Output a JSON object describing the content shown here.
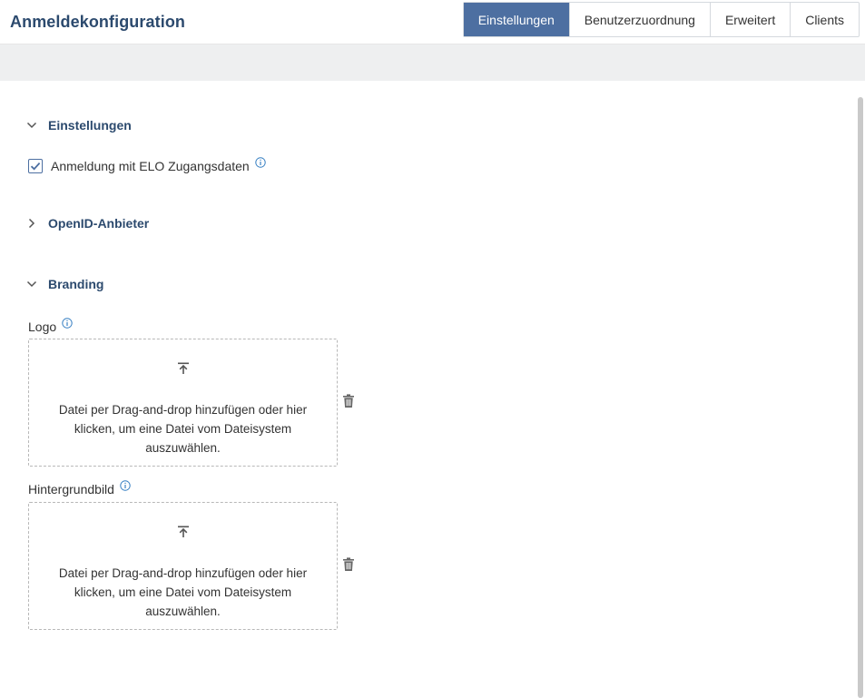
{
  "header": {
    "title": "Anmeldekonfiguration",
    "tabs": [
      {
        "label": "Einstellungen",
        "active": true
      },
      {
        "label": "Benutzerzuordnung",
        "active": false
      },
      {
        "label": "Erweitert",
        "active": false
      },
      {
        "label": "Clients",
        "active": false
      }
    ]
  },
  "sections": {
    "einstellungen": {
      "title": "Einstellungen",
      "expanded": true,
      "checkbox_label": "Anmeldung mit ELO Zugangsdaten",
      "checked": true
    },
    "openid": {
      "title": "OpenID-Anbieter",
      "expanded": false
    },
    "branding": {
      "title": "Branding",
      "expanded": true,
      "logo": {
        "label": "Logo",
        "drop_text": "Datei per Drag-and-drop hinzufügen oder hier klicken, um eine Datei vom Dateisystem auszuwählen."
      },
      "background": {
        "label": "Hintergrundbild",
        "drop_text": "Datei per Drag-and-drop hinzufügen oder hier klicken, um eine Datei vom Dateisystem auszuwählen."
      }
    }
  },
  "icons": {
    "chevron_down": "chevron-down-icon",
    "chevron_right": "chevron-right-icon",
    "info": "info-icon",
    "upload": "upload-icon",
    "trash": "trash-icon",
    "check": "check-icon"
  },
  "colors": {
    "accent": "#4d6fa1",
    "title": "#2c4a6e",
    "info": "#3b82c4"
  }
}
